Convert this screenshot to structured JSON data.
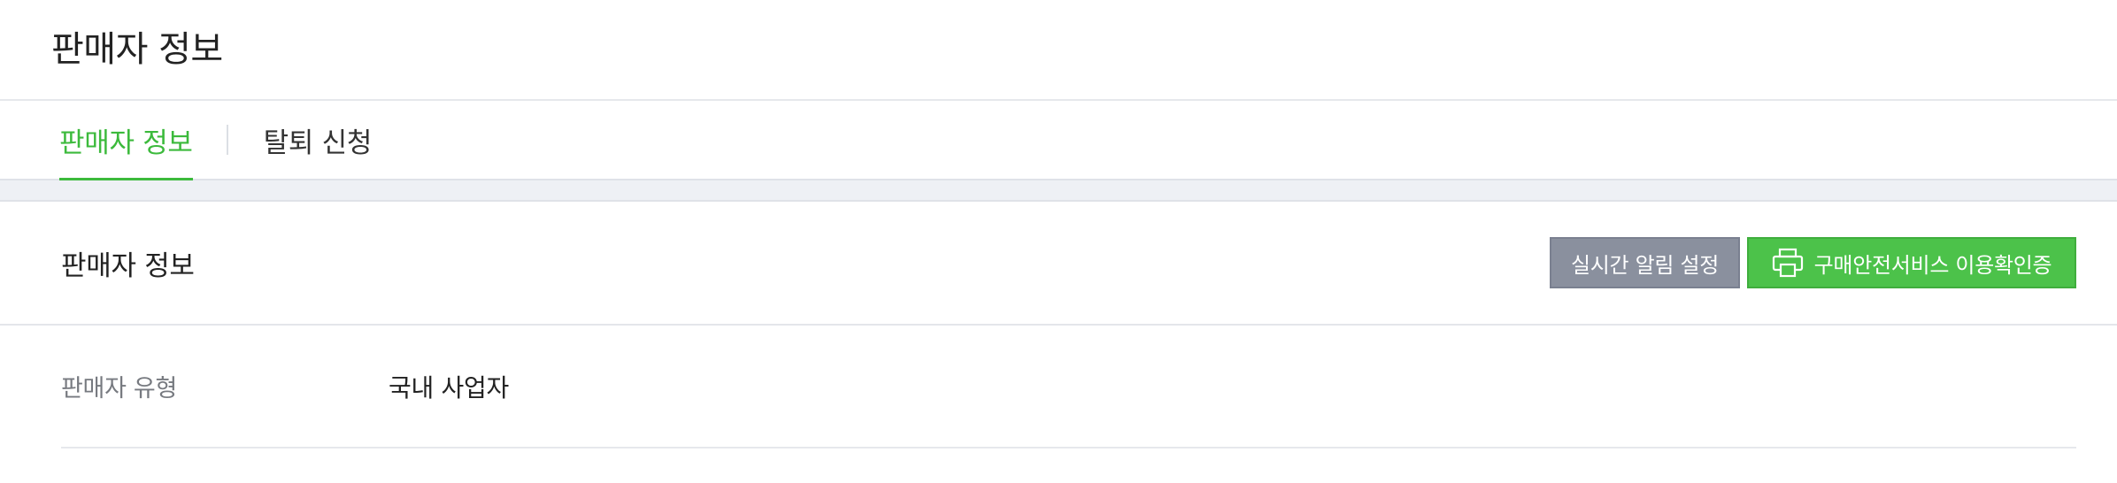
{
  "header": {
    "title": "판매자 정보"
  },
  "tabs": [
    {
      "label": "판매자 정보",
      "active": true
    },
    {
      "label": "탈퇴 신청",
      "active": false
    }
  ],
  "section": {
    "title": "판매자 정보",
    "buttons": {
      "notification_label": "실시간 알림 설정",
      "certificate_label": "구매안전서비스 이용확인증",
      "certificate_icon": "printer-icon"
    }
  },
  "info_rows": [
    {
      "label": "판매자 유형",
      "value": "국내 사업자"
    }
  ],
  "colors": {
    "accent": "#3cba3c",
    "button_gray": "#8a909e",
    "button_green": "#4cc24a"
  }
}
